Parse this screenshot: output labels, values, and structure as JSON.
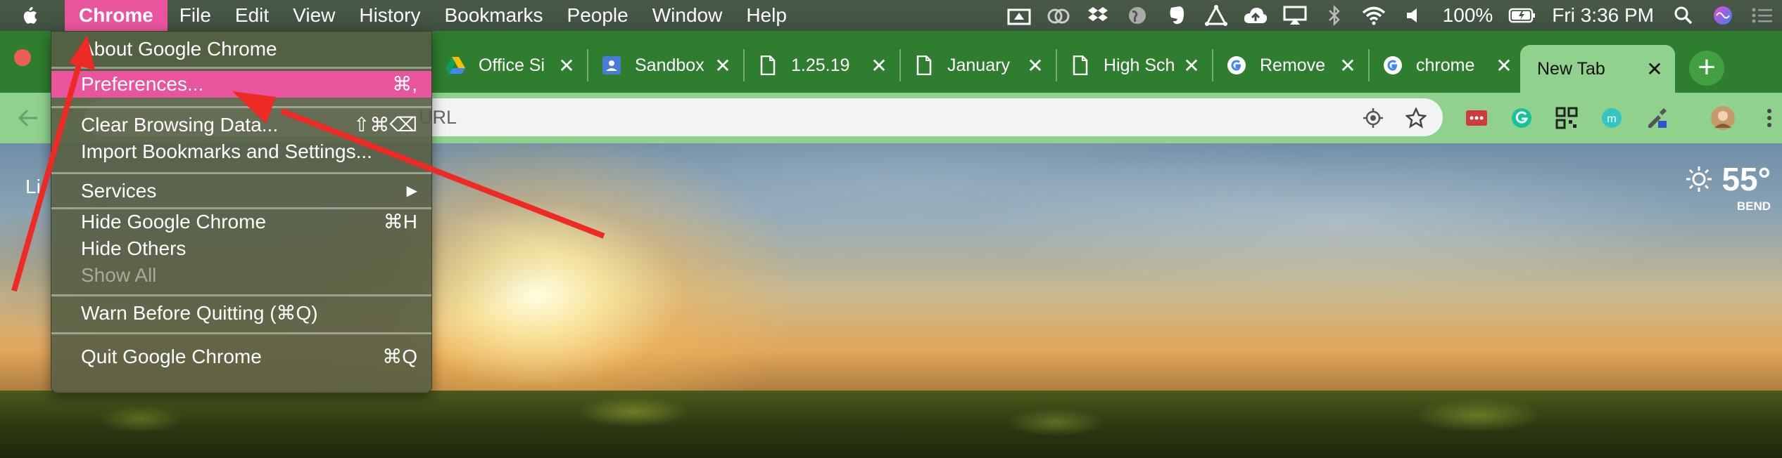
{
  "menubar": {
    "items": [
      "Chrome",
      "File",
      "Edit",
      "View",
      "History",
      "Bookmarks",
      "People",
      "Window",
      "Help"
    ],
    "battery": "100%",
    "clock": "Fri 3:36 PM"
  },
  "tabs": [
    {
      "title": "Office Si",
      "icon": "google-drive-icon"
    },
    {
      "title": "Sandbox",
      "icon": "google-classroom-icon"
    },
    {
      "title": "1.25.19",
      "icon": "document-icon"
    },
    {
      "title": "January",
      "icon": "document-icon"
    },
    {
      "title": "High Sch",
      "icon": "document-icon"
    },
    {
      "title": "Remove",
      "icon": "google-icon"
    },
    {
      "title": "chrome",
      "icon": "google-icon"
    },
    {
      "title": "New Tab",
      "icon": ""
    }
  ],
  "omnibox": {
    "placeholder": "URL"
  },
  "page": {
    "left_text": "Li",
    "weather": {
      "temp": "55°",
      "location": "BEND"
    }
  },
  "chrome_menu": {
    "items": [
      {
        "label": "About Google Chrome",
        "shortcut": ""
      },
      {
        "label": "Preferences...",
        "shortcut": "⌘,"
      },
      {
        "label": "Clear Browsing Data...",
        "shortcut": "⇧⌘⌫"
      },
      {
        "label": "Import Bookmarks and Settings...",
        "shortcut": ""
      },
      {
        "label": "Services",
        "shortcut": "▶"
      },
      {
        "label": "Hide Google Chrome",
        "shortcut": "⌘H"
      },
      {
        "label": "Hide Others",
        "shortcut": ""
      },
      {
        "label": "Show All",
        "shortcut": ""
      },
      {
        "label": "Warn Before Quitting (⌘Q)",
        "shortcut": ""
      },
      {
        "label": "Quit Google Chrome",
        "shortcut": "⌘Q"
      }
    ]
  },
  "colors": {
    "menubar": "#3f5040",
    "highlight": "#e9559c",
    "tabstrip": "#2f7d2f",
    "active_tab": "#8fd18d",
    "annotation": "#ee2a24"
  }
}
